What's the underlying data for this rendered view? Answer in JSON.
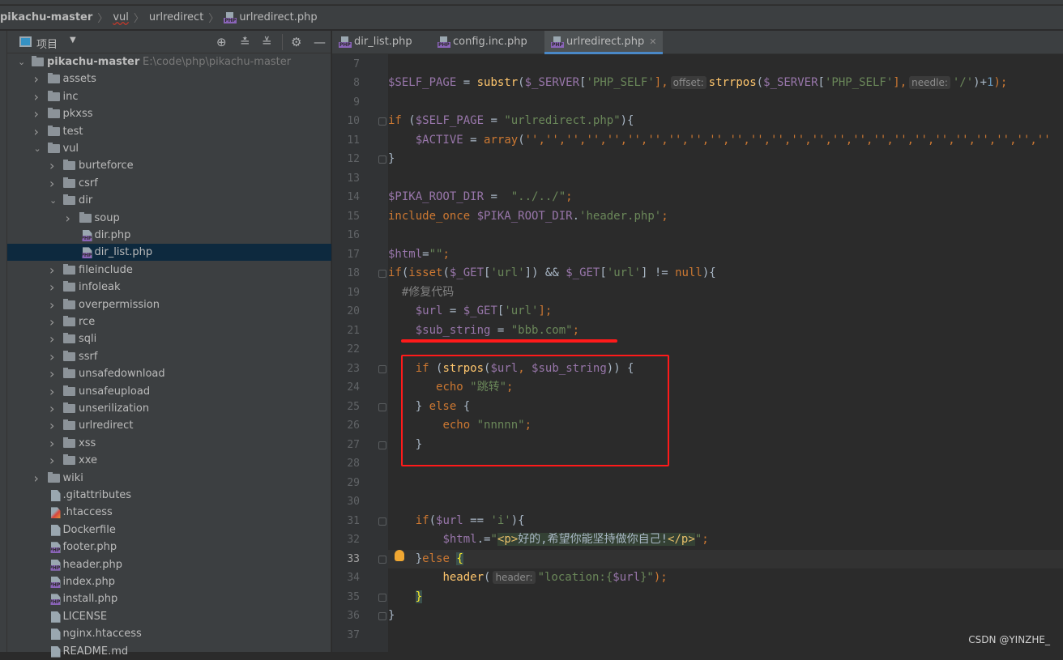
{
  "breadcrumb": [
    "pikachu-master",
    "vul",
    "urlredirect",
    "urlredirect.php"
  ],
  "panel": {
    "title": "项目",
    "side_label": "项目"
  },
  "tree": [
    {
      "label": "pikachu-master",
      "path": "E:\\code\\php\\pikachu-master",
      "depth": 0,
      "type": "folder",
      "open": true
    },
    {
      "label": "assets",
      "depth": 1,
      "type": "folder"
    },
    {
      "label": "inc",
      "depth": 1,
      "type": "folder"
    },
    {
      "label": "pkxss",
      "depth": 1,
      "type": "folder"
    },
    {
      "label": "test",
      "depth": 1,
      "type": "folder"
    },
    {
      "label": "vul",
      "depth": 1,
      "type": "folder",
      "open": true
    },
    {
      "label": "burteforce",
      "depth": 2,
      "type": "folder"
    },
    {
      "label": "csrf",
      "depth": 2,
      "type": "folder"
    },
    {
      "label": "dir",
      "depth": 2,
      "type": "folder",
      "open": true
    },
    {
      "label": "soup",
      "depth": 3,
      "type": "folder"
    },
    {
      "label": "dir.php",
      "depth": 3,
      "type": "php"
    },
    {
      "label": "dir_list.php",
      "depth": 3,
      "type": "php",
      "selected": true
    },
    {
      "label": "fileinclude",
      "depth": 2,
      "type": "folder"
    },
    {
      "label": "infoleak",
      "depth": 2,
      "type": "folder"
    },
    {
      "label": "overpermission",
      "depth": 2,
      "type": "folder"
    },
    {
      "label": "rce",
      "depth": 2,
      "type": "folder"
    },
    {
      "label": "sqli",
      "depth": 2,
      "type": "folder"
    },
    {
      "label": "ssrf",
      "depth": 2,
      "type": "folder"
    },
    {
      "label": "unsafedownload",
      "depth": 2,
      "type": "folder"
    },
    {
      "label": "unsafeupload",
      "depth": 2,
      "type": "folder"
    },
    {
      "label": "unserilization",
      "depth": 2,
      "type": "folder"
    },
    {
      "label": "urlredirect",
      "depth": 2,
      "type": "folder"
    },
    {
      "label": "xss",
      "depth": 2,
      "type": "folder"
    },
    {
      "label": "xxe",
      "depth": 2,
      "type": "folder"
    },
    {
      "label": "wiki",
      "depth": 1,
      "type": "folder"
    },
    {
      "label": ".gitattributes",
      "depth": 1,
      "type": "text"
    },
    {
      "label": ".htaccess",
      "depth": 1,
      "type": "ht"
    },
    {
      "label": "Dockerfile",
      "depth": 1,
      "type": "docker"
    },
    {
      "label": "footer.php",
      "depth": 1,
      "type": "php"
    },
    {
      "label": "header.php",
      "depth": 1,
      "type": "php"
    },
    {
      "label": "index.php",
      "depth": 1,
      "type": "php"
    },
    {
      "label": "install.php",
      "depth": 1,
      "type": "php"
    },
    {
      "label": "LICENSE",
      "depth": 1,
      "type": "text"
    },
    {
      "label": "nginx.htaccess",
      "depth": 1,
      "type": "text"
    },
    {
      "label": "README.md",
      "depth": 1,
      "type": "text"
    }
  ],
  "tabs": [
    {
      "label": "dir_list.php"
    },
    {
      "label": "config.inc.php"
    },
    {
      "label": "urlredirect.php",
      "active": true
    }
  ],
  "editor": {
    "current_line": 33,
    "lines": [
      {
        "n": 7,
        "t": []
      },
      {
        "n": 8,
        "t": [
          [
            "$SELF_PAGE",
            "v"
          ],
          [
            " = ",
            "p"
          ],
          [
            "substr",
            "f"
          ],
          [
            "(",
            "p"
          ],
          [
            "$_SERVER",
            "v"
          ],
          [
            "[",
            "p"
          ],
          [
            "'PHP_SELF'",
            "s"
          ],
          [
            "],",
            "k"
          ],
          [
            "offset:",
            "h"
          ],
          [
            "strrpos",
            "f"
          ],
          [
            "(",
            "p"
          ],
          [
            "$_SERVER",
            "v"
          ],
          [
            "[",
            "p"
          ],
          [
            "'PHP_SELF'",
            "s"
          ],
          [
            "],",
            "k"
          ],
          [
            "needle:",
            "h"
          ],
          [
            "'/'",
            "s"
          ],
          [
            ")+",
            "p"
          ],
          [
            "1",
            "n"
          ],
          [
            ");",
            "k"
          ]
        ]
      },
      {
        "n": 9,
        "t": []
      },
      {
        "n": 10,
        "t": [
          [
            "if ",
            "k"
          ],
          [
            "(",
            "p"
          ],
          [
            "$SELF_PAGE",
            "v"
          ],
          [
            " = ",
            "p"
          ],
          [
            "\"urlredirect.php\"",
            "s"
          ],
          [
            "){",
            "p"
          ]
        ]
      },
      {
        "n": 11,
        "t": [
          [
            "    ",
            "p"
          ],
          [
            "$ACTIVE",
            "v"
          ],
          [
            " = ",
            "p"
          ],
          [
            "array",
            "k"
          ],
          [
            "(",
            "p"
          ],
          [
            "'','','','','','','','','','','','','','','','','','','','','','','','','',''",
            "k"
          ]
        ]
      },
      {
        "n": 12,
        "t": [
          [
            "}",
            "p"
          ]
        ]
      },
      {
        "n": 13,
        "t": []
      },
      {
        "n": 14,
        "t": [
          [
            "$PIKA_ROOT_DIR",
            "v"
          ],
          [
            " =  ",
            "p"
          ],
          [
            "\"../../\"",
            "s"
          ],
          [
            ";",
            "k"
          ]
        ]
      },
      {
        "n": 15,
        "t": [
          [
            "include_once ",
            "k"
          ],
          [
            "$PIKA_ROOT_DIR",
            "v"
          ],
          [
            ".",
            "p"
          ],
          [
            "'header.php'",
            "s"
          ],
          [
            ";",
            "k"
          ]
        ]
      },
      {
        "n": 16,
        "t": []
      },
      {
        "n": 17,
        "t": [
          [
            "$html",
            "v"
          ],
          [
            "=",
            "p"
          ],
          [
            "\"\"",
            "s"
          ],
          [
            ";",
            "k"
          ]
        ]
      },
      {
        "n": 18,
        "t": [
          [
            "if",
            "k"
          ],
          [
            "(",
            "p"
          ],
          [
            "isset",
            "k"
          ],
          [
            "(",
            "p"
          ],
          [
            "$_GET",
            "v"
          ],
          [
            "[",
            "p"
          ],
          [
            "'url'",
            "s"
          ],
          [
            "]) && ",
            "p"
          ],
          [
            "$_GET",
            "v"
          ],
          [
            "[",
            "p"
          ],
          [
            "'url'",
            "s"
          ],
          [
            "] != ",
            "p"
          ],
          [
            "null",
            "k"
          ],
          [
            "){",
            "p"
          ]
        ]
      },
      {
        "n": 19,
        "t": [
          [
            "  #修复代码",
            "c"
          ]
        ]
      },
      {
        "n": 20,
        "t": [
          [
            "    ",
            "p"
          ],
          [
            "$url",
            "v"
          ],
          [
            " = ",
            "p"
          ],
          [
            "$_GET",
            "v"
          ],
          [
            "[",
            "p"
          ],
          [
            "'url'",
            "s"
          ],
          [
            "];",
            "k"
          ]
        ]
      },
      {
        "n": 21,
        "t": [
          [
            "    ",
            "p"
          ],
          [
            "$sub_string",
            "v"
          ],
          [
            " = ",
            "p"
          ],
          [
            "\"bbb.com\"",
            "s"
          ],
          [
            ";",
            "k"
          ]
        ]
      },
      {
        "n": 22,
        "t": []
      },
      {
        "n": 23,
        "t": [
          [
            "    ",
            "p"
          ],
          [
            "if ",
            "k"
          ],
          [
            "(",
            "p"
          ],
          [
            "strpos",
            "f"
          ],
          [
            "(",
            "p"
          ],
          [
            "$url",
            "v"
          ],
          [
            ", ",
            "k"
          ],
          [
            "$sub_string",
            "v"
          ],
          [
            ")) {",
            "p"
          ]
        ]
      },
      {
        "n": 24,
        "t": [
          [
            "       ",
            "p"
          ],
          [
            "echo ",
            "k"
          ],
          [
            "\"跳转\"",
            "s"
          ],
          [
            ";",
            "k"
          ]
        ]
      },
      {
        "n": 25,
        "t": [
          [
            "    ",
            "p"
          ],
          [
            "} ",
            "p"
          ],
          [
            "else ",
            "k"
          ],
          [
            "{",
            "p"
          ]
        ]
      },
      {
        "n": 26,
        "t": [
          [
            "        ",
            "p"
          ],
          [
            "echo ",
            "k"
          ],
          [
            "\"nnnnn\"",
            "s"
          ],
          [
            ";",
            "k"
          ]
        ]
      },
      {
        "n": 27,
        "t": [
          [
            "    ",
            "p"
          ],
          [
            "}",
            "p"
          ]
        ]
      },
      {
        "n": 28,
        "t": []
      },
      {
        "n": 29,
        "t": []
      },
      {
        "n": 30,
        "t": []
      },
      {
        "n": 31,
        "t": [
          [
            "    ",
            "p"
          ],
          [
            "if",
            "k"
          ],
          [
            "(",
            "p"
          ],
          [
            "$url",
            "v"
          ],
          [
            " == ",
            "p"
          ],
          [
            "'i'",
            "s"
          ],
          [
            "){",
            "p"
          ]
        ]
      },
      {
        "n": 32,
        "t": [
          [
            "        ",
            "p"
          ],
          [
            "$html",
            "v"
          ],
          [
            ".=",
            "p"
          ],
          [
            "\"",
            "s"
          ],
          [
            "<p>",
            "t"
          ],
          [
            "好的,希望你能坚持做你自己!",
            "tt"
          ],
          [
            "</p>",
            "t"
          ],
          [
            "\"",
            "s"
          ],
          [
            ";",
            "k"
          ]
        ]
      },
      {
        "n": 33,
        "t": [
          [
            "    ",
            "p"
          ],
          [
            "}",
            "p"
          ],
          [
            "else ",
            "k"
          ],
          [
            "{",
            "y"
          ]
        ]
      },
      {
        "n": 34,
        "t": [
          [
            "        ",
            "p"
          ],
          [
            "header",
            "f"
          ],
          [
            "(",
            "p"
          ],
          [
            "header:",
            "h"
          ],
          [
            "\"location:{",
            "s"
          ],
          [
            "$url",
            "v"
          ],
          [
            "}\"",
            "s"
          ],
          [
            ");",
            "k"
          ]
        ]
      },
      {
        "n": 35,
        "t": [
          [
            "    ",
            "p"
          ],
          [
            "}",
            "y"
          ]
        ]
      },
      {
        "n": 36,
        "t": [
          [
            "}",
            "p"
          ]
        ]
      },
      {
        "n": 37,
        "t": []
      }
    ]
  },
  "folds": [
    10,
    12,
    18,
    23,
    25,
    27,
    31,
    33,
    35,
    36
  ],
  "watermark": "CSDN @YINZHE_"
}
